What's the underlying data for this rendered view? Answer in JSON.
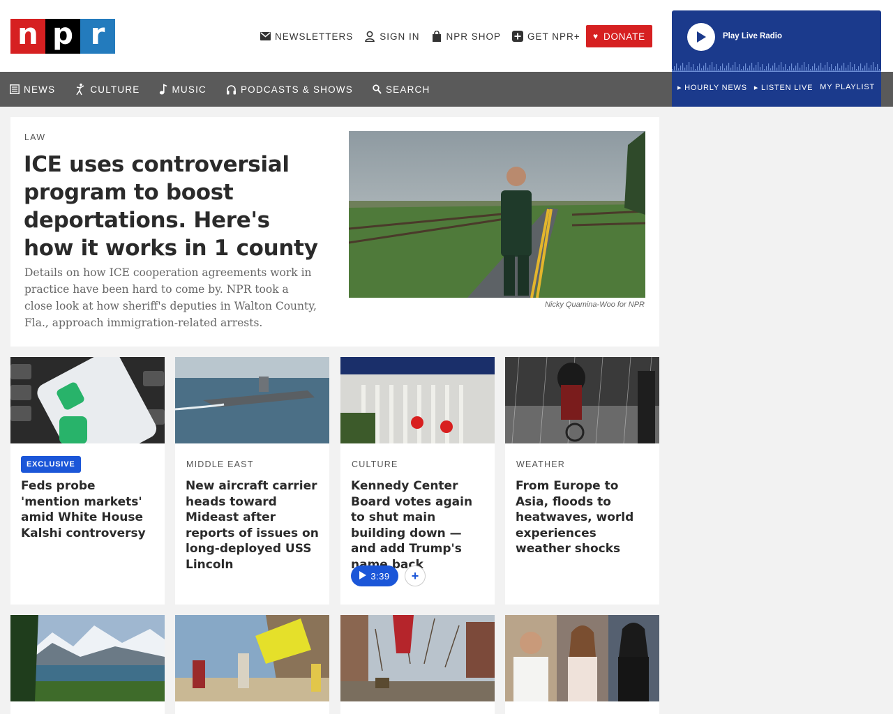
{
  "logo": {
    "letters": [
      "n",
      "p",
      "r"
    ]
  },
  "utility_nav": [
    {
      "label": "NEWSLETTERS",
      "icon": "envelope-icon"
    },
    {
      "label": "SIGN IN",
      "icon": "user-icon"
    },
    {
      "label": "NPR SHOP",
      "icon": "shopping-bag-icon"
    },
    {
      "label": "GET NPR+",
      "icon": "plus-box-icon"
    }
  ],
  "donate": {
    "label": "DONATE",
    "icon": "heart-icon",
    "color": "#d62021"
  },
  "main_nav": [
    {
      "label": "NEWS",
      "icon": "newspaper-icon"
    },
    {
      "label": "CULTURE",
      "icon": "dancer-icon"
    },
    {
      "label": "MUSIC",
      "icon": "music-note-icon"
    },
    {
      "label": "PODCASTS & SHOWS",
      "icon": "headphones-icon"
    },
    {
      "label": "SEARCH",
      "icon": "search-icon"
    }
  ],
  "player": {
    "title": "Play Live Radio",
    "links": [
      "▸ HOURLY NEWS",
      "▸ LISTEN LIVE",
      "MY PLAYLIST"
    ],
    "color": "#1b3a8c"
  },
  "hero": {
    "slug": "LAW",
    "title": "ICE uses controversial program to boost deportations. Here's how it works in 1 county",
    "teaser": "Details on how ICE cooperation agreements work in practice have been hard to come by. NPR took a close look at how sheriff's deputies in Walton County, Fla., approach immigration-related arrests.",
    "credit": "Nicky Quamina-Woo for NPR"
  },
  "cards": [
    {
      "badge": "EXCLUSIVE",
      "title": "Feds probe 'mention markets' amid White House Kalshi controversy"
    },
    {
      "slug": "MIDDLE EAST",
      "title": "New aircraft carrier heads toward Mideast after reports of issues on long-deployed USS Lincoln"
    },
    {
      "slug": "CULTURE",
      "title": "Kennedy Center Board votes again to shut main building down — and add Trump's name back",
      "audio": "3:39"
    },
    {
      "slug": "WEATHER",
      "title": "From Europe to Asia, floods to heatwaves, world experiences weather shocks"
    }
  ]
}
